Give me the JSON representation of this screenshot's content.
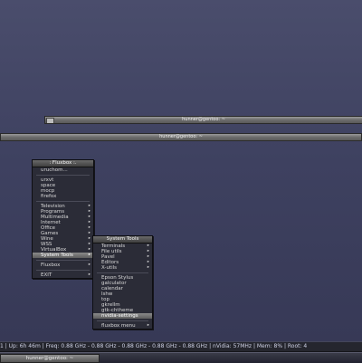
{
  "windows": [
    {
      "title": "hunner@gentoo: ~"
    },
    {
      "title": "hunner@gentoo: ~"
    }
  ],
  "root_menu": {
    "title": ": Fluxbox :.",
    "items": [
      {
        "label": "uruchom...",
        "arrow": false
      },
      {
        "sep": true
      },
      {
        "label": "urxvt",
        "arrow": false
      },
      {
        "label": "space",
        "arrow": false
      },
      {
        "label": "mocp",
        "arrow": false
      },
      {
        "label": "firefox",
        "arrow": false
      },
      {
        "sep": true
      },
      {
        "label": "Television",
        "arrow": true
      },
      {
        "label": "Programs",
        "arrow": true
      },
      {
        "label": "Multimedia",
        "arrow": true
      },
      {
        "label": "Internet",
        "arrow": true
      },
      {
        "label": "Office",
        "arrow": true
      },
      {
        "label": "Games",
        "arrow": true
      },
      {
        "label": "Wine",
        "arrow": true
      },
      {
        "label": "WSS",
        "arrow": true
      },
      {
        "label": "VirtualBox",
        "arrow": true
      },
      {
        "label": "System Tools",
        "arrow": true,
        "highlighted": true
      },
      {
        "sep": true
      },
      {
        "label": "Fluxbox",
        "arrow": true
      },
      {
        "sep": true
      },
      {
        "label": "EXIT",
        "arrow": true
      }
    ]
  },
  "sub_menu": {
    "title": "System Tools",
    "items": [
      {
        "label": "Terminals",
        "arrow": true
      },
      {
        "label": "File utils",
        "arrow": true
      },
      {
        "label": "Pavel",
        "arrow": true
      },
      {
        "label": "Editors",
        "arrow": true
      },
      {
        "label": "X-utils",
        "arrow": true
      },
      {
        "sep": true
      },
      {
        "label": "Epson Stylus",
        "arrow": false
      },
      {
        "label": "galculator",
        "arrow": false
      },
      {
        "label": "calendar",
        "arrow": false
      },
      {
        "label": "lshw",
        "arrow": false
      },
      {
        "label": "top",
        "arrow": false
      },
      {
        "label": "gkrellm",
        "arrow": false
      },
      {
        "label": "gtk-chtheme",
        "arrow": false
      },
      {
        "label": "nvidia-settings",
        "arrow": false,
        "highlighted": true
      },
      {
        "sep": true
      },
      {
        "label": "fluxbox menu",
        "arrow": true
      }
    ]
  },
  "status": {
    "text": "1 | Up: 6h 46m | Freq: 0.88 GHz - 0.88 GHz - 0.88 GHz - 0.88 GHz - 0.88 GHz | nVidia: 57MHz | Mem: 8% | Root: 4"
  },
  "taskbar": {
    "items": [
      {
        "label": "hunner@gentoo: ~"
      }
    ]
  },
  "icons": {
    "arrow": "▸",
    "window_button": "window-button-icon"
  }
}
